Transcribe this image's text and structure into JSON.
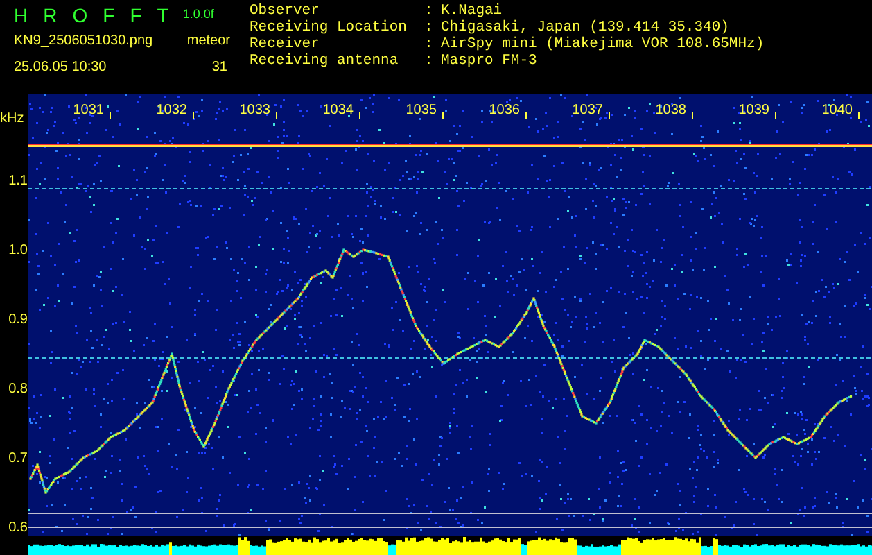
{
  "header": {
    "title_letters": [
      "H",
      "R",
      "O",
      "F",
      "F",
      "T"
    ],
    "version": "1.0.0f",
    "filename": "KN9_2506051030.png",
    "datetime": "25.06.05 10:30",
    "meteor_label": "meteor",
    "meteor_count": "31",
    "info": [
      {
        "label": "Observer",
        "separator": ":",
        "value": "K.Nagai"
      },
      {
        "label": "Receiving Location",
        "separator": ":",
        "value": "Chigasaki, Japan (139.414 35.340)"
      },
      {
        "label": "Receiver",
        "separator": ":",
        "value": "AirSpy mini (Miakejima VOR 108.65MHz)"
      },
      {
        "label": "Receiving antenna",
        "separator": ":",
        "value": "Maspro FM-3"
      }
    ]
  },
  "spectrogram": {
    "y_unit": "kHz",
    "y_labels": [
      "1.1",
      "1.0",
      "0.9",
      "0.8",
      "0.7",
      "0.6"
    ],
    "x_labels": [
      "1031",
      "1032",
      "1033",
      "1034",
      "1035",
      "1036",
      "1037",
      "1038",
      "1039",
      "1040"
    ]
  }
}
